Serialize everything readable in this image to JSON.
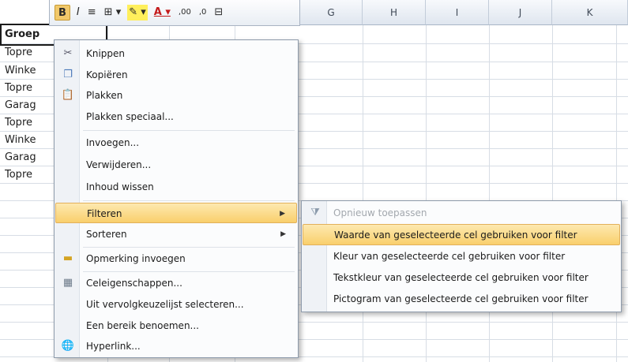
{
  "window": {
    "app": "Excel"
  },
  "mini_toolbar": {
    "items": [
      {
        "name": "bold-button",
        "label": "B"
      },
      {
        "name": "italic-button",
        "label": "I"
      },
      {
        "name": "align-center-button",
        "label": "≡"
      },
      {
        "name": "borders-button",
        "label": "⊞ ▾"
      },
      {
        "name": "fill-color-button",
        "label": "✎ ▾"
      },
      {
        "name": "font-color-button",
        "label": "A ▾"
      },
      {
        "name": "increase-decimals-button",
        "label": ",00"
      },
      {
        "name": "decrease-decimals-button",
        "label": ",0"
      },
      {
        "name": "merge-button",
        "label": "⊟"
      }
    ]
  },
  "columns": [
    "G",
    "H",
    "I",
    "J",
    "K"
  ],
  "cells": [
    "Groep",
    "Topre",
    "Winke",
    "Topre",
    "Garag",
    "Topre",
    "Winke",
    "Garag",
    "Topre"
  ],
  "context_menu": {
    "items": [
      {
        "label": "Knippen",
        "icon": "scissors-icon"
      },
      {
        "label": "Kopiëren",
        "icon": "copy-icon"
      },
      {
        "label": "Plakken",
        "icon": "paste-icon"
      },
      {
        "label": "Plakken speciaal...",
        "icon": ""
      },
      {
        "label": "Invoegen...",
        "icon": ""
      },
      {
        "label": "Verwijderen...",
        "icon": ""
      },
      {
        "label": "Inhoud wissen",
        "icon": ""
      },
      {
        "label": "Filteren",
        "icon": "",
        "submenu": true,
        "highlighted": true
      },
      {
        "label": "Sorteren",
        "icon": "",
        "submenu": true
      },
      {
        "label": "Opmerking invoegen",
        "icon": "comment-icon"
      },
      {
        "label": "Celeigenschappen...",
        "icon": "format-cells-icon"
      },
      {
        "label": "Uit vervolgkeuzelijst selecteren...",
        "icon": ""
      },
      {
        "label": "Een bereik benoemen...",
        "icon": ""
      },
      {
        "label": "Hyperlink...",
        "icon": "hyperlink-icon"
      }
    ]
  },
  "filter_submenu": {
    "items": [
      {
        "label": "Opnieuw toepassen",
        "icon": "reapply-filter-icon",
        "disabled": true
      },
      {
        "label": "Waarde van geselecteerde cel gebruiken voor filter",
        "highlighted": true
      },
      {
        "label": "Kleur van geselecteerde cel gebruiken voor filter"
      },
      {
        "label": "Tekstkleur van geselecteerde cel gebruiken voor filter"
      },
      {
        "label": "Pictogram van geselecteerde cel gebruiken voor filter"
      }
    ]
  },
  "colors": {
    "highlight": "#f9cf6c",
    "menu_border": "#8e9bab",
    "grid_line": "#d7dde5"
  }
}
